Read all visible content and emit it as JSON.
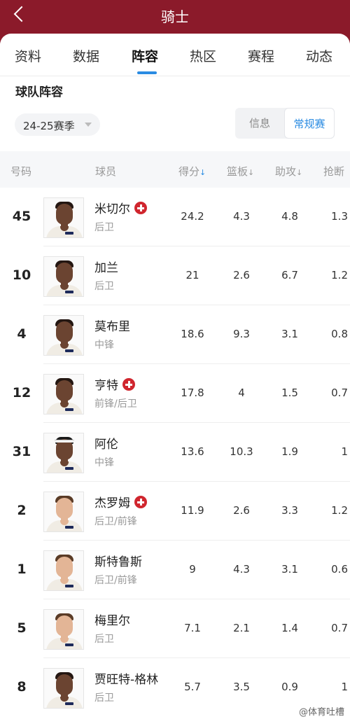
{
  "header": {
    "title": "骑士"
  },
  "tabs": [
    {
      "label": "资料"
    },
    {
      "label": "数据"
    },
    {
      "label": "阵容"
    },
    {
      "label": "热区"
    },
    {
      "label": "赛程"
    },
    {
      "label": "动态"
    }
  ],
  "active_tab": "阵容",
  "section": {
    "title": "球队阵容"
  },
  "season_selector": {
    "value": "24-25赛季"
  },
  "segments": {
    "info": "信息",
    "regular": "常规赛",
    "selected": "常规赛"
  },
  "table": {
    "headers": {
      "number": "号码",
      "player": "球员",
      "points": "得分",
      "rebounds": "篮板",
      "assists": "助攻",
      "steals": "抢断"
    },
    "sort_arrow": "↓",
    "rows": [
      {
        "number": "45",
        "name": "米切尔",
        "position": "后卫",
        "injured": true,
        "points": "24.2",
        "rebounds": "4.3",
        "assists": "4.8",
        "steals": "1.3"
      },
      {
        "number": "10",
        "name": "加兰",
        "position": "后卫",
        "injured": false,
        "points": "21",
        "rebounds": "2.6",
        "assists": "6.7",
        "steals": "1.2"
      },
      {
        "number": "4",
        "name": "莫布里",
        "position": "中锋",
        "injured": false,
        "points": "18.6",
        "rebounds": "9.3",
        "assists": "3.1",
        "steals": "0.8"
      },
      {
        "number": "12",
        "name": "亨特",
        "position": "前锋/后卫",
        "injured": true,
        "points": "17.8",
        "rebounds": "4",
        "assists": "1.5",
        "steals": "0.7"
      },
      {
        "number": "31",
        "name": "阿伦",
        "position": "中锋",
        "injured": false,
        "points": "13.6",
        "rebounds": "10.3",
        "assists": "1.9",
        "steals": "1"
      },
      {
        "number": "2",
        "name": "杰罗姆",
        "position": "后卫/前锋",
        "injured": true,
        "points": "11.9",
        "rebounds": "2.6",
        "assists": "3.3",
        "steals": "1.2"
      },
      {
        "number": "1",
        "name": "斯特鲁斯",
        "position": "后卫/前锋",
        "injured": false,
        "points": "9",
        "rebounds": "4.3",
        "assists": "3.1",
        "steals": "0.6"
      },
      {
        "number": "5",
        "name": "梅里尔",
        "position": "后卫",
        "injured": false,
        "points": "7.1",
        "rebounds": "2.1",
        "assists": "1.4",
        "steals": "0.7"
      },
      {
        "number": "8",
        "name": "贾旺特-格林",
        "position": "后卫",
        "injured": false,
        "points": "5.7",
        "rebounds": "3.5",
        "assists": "0.9",
        "steals": "1"
      }
    ]
  },
  "watermark": "@体育吐槽",
  "colors": {
    "header_bg": "#8b1a2a",
    "accent_blue": "#2a8be2",
    "injury_red": "#d0262e"
  }
}
